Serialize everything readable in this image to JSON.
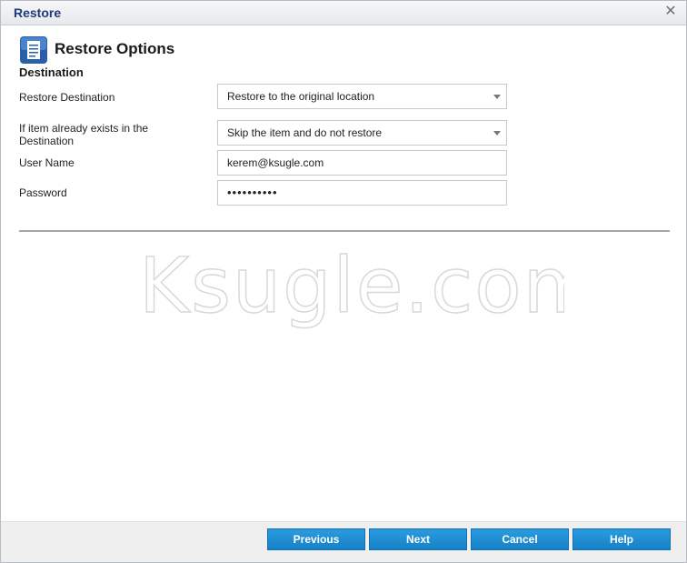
{
  "window": {
    "title": "Restore"
  },
  "header": {
    "title": "Restore Options",
    "icon": "document-list-icon"
  },
  "section": {
    "title": "Destination"
  },
  "fields": {
    "restore_destination": {
      "label": "Restore Destination",
      "value": "Restore to the original location"
    },
    "if_exists": {
      "label_line1": "If item already exists in the",
      "label_line2": "Destination",
      "value": "Skip the item and do not restore"
    },
    "user_name": {
      "label": "User Name",
      "value": "kerem@ksugle.com"
    },
    "password": {
      "label": "Password",
      "value": "••••••••••"
    }
  },
  "watermark": {
    "text": "Ksugle.com"
  },
  "buttons": {
    "previous": "Previous",
    "next": "Next",
    "cancel": "Cancel",
    "help": "Help"
  },
  "colors": {
    "title": "#1f3a78",
    "button": "#1a8ad4",
    "footer": "#efefef"
  }
}
